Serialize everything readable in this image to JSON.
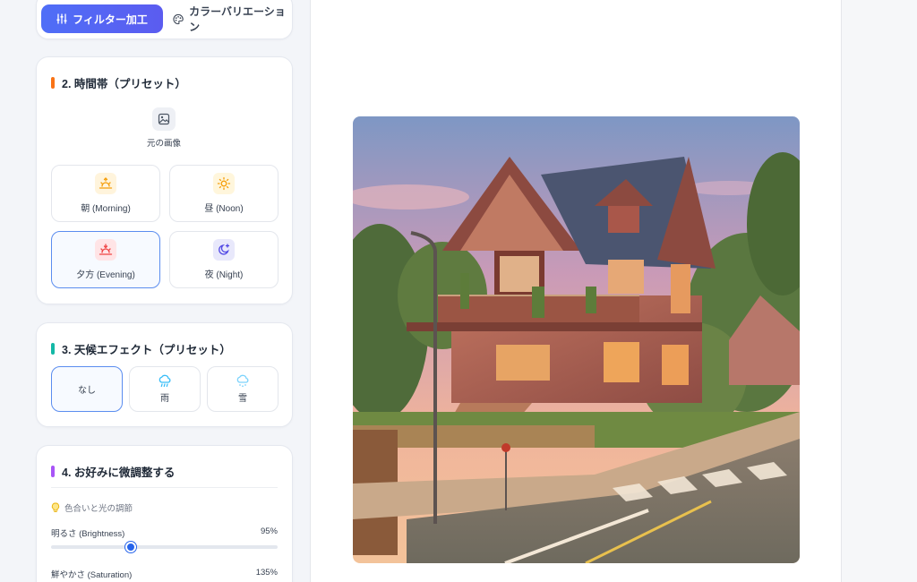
{
  "mode_tabs": {
    "filter_label": "フィルター加工",
    "color_label": "カラーバリエーション"
  },
  "time_section": {
    "title": "2. 時間帯（プリセット）",
    "accent_color": "#f97316",
    "original_label": "元の画像",
    "presets": [
      {
        "label": "朝 (Morning)",
        "icon": "sunrise-icon"
      },
      {
        "label": "昼 (Noon)",
        "icon": "sun-icon"
      },
      {
        "label": "夕方 (Evening)",
        "icon": "sunset-icon",
        "selected": true
      },
      {
        "label": "夜 (Night)",
        "icon": "moon-star-icon"
      }
    ]
  },
  "weather_section": {
    "title": "3. 天候エフェクト（プリセット）",
    "accent_color": "#14b8a6",
    "options": [
      {
        "label": "なし",
        "selected": true
      },
      {
        "label": "雨",
        "icon": "rain-cloud-icon"
      },
      {
        "label": "雪",
        "icon": "snow-cloud-icon"
      }
    ]
  },
  "adjust_section": {
    "title": "4. お好みに微調整する",
    "accent_color": "#a855f7",
    "subheading": "色合いと光の調節",
    "sliders": [
      {
        "label": "明るさ (Brightness)",
        "value_text": "95%",
        "fraction": 0.35
      },
      {
        "label": "鮮やかさ (Saturation)",
        "value_text": "135%"
      }
    ]
  },
  "colors": {
    "primary": "#4f6ef7",
    "selected_border": "#5b8def",
    "slider": "#2563eb"
  }
}
